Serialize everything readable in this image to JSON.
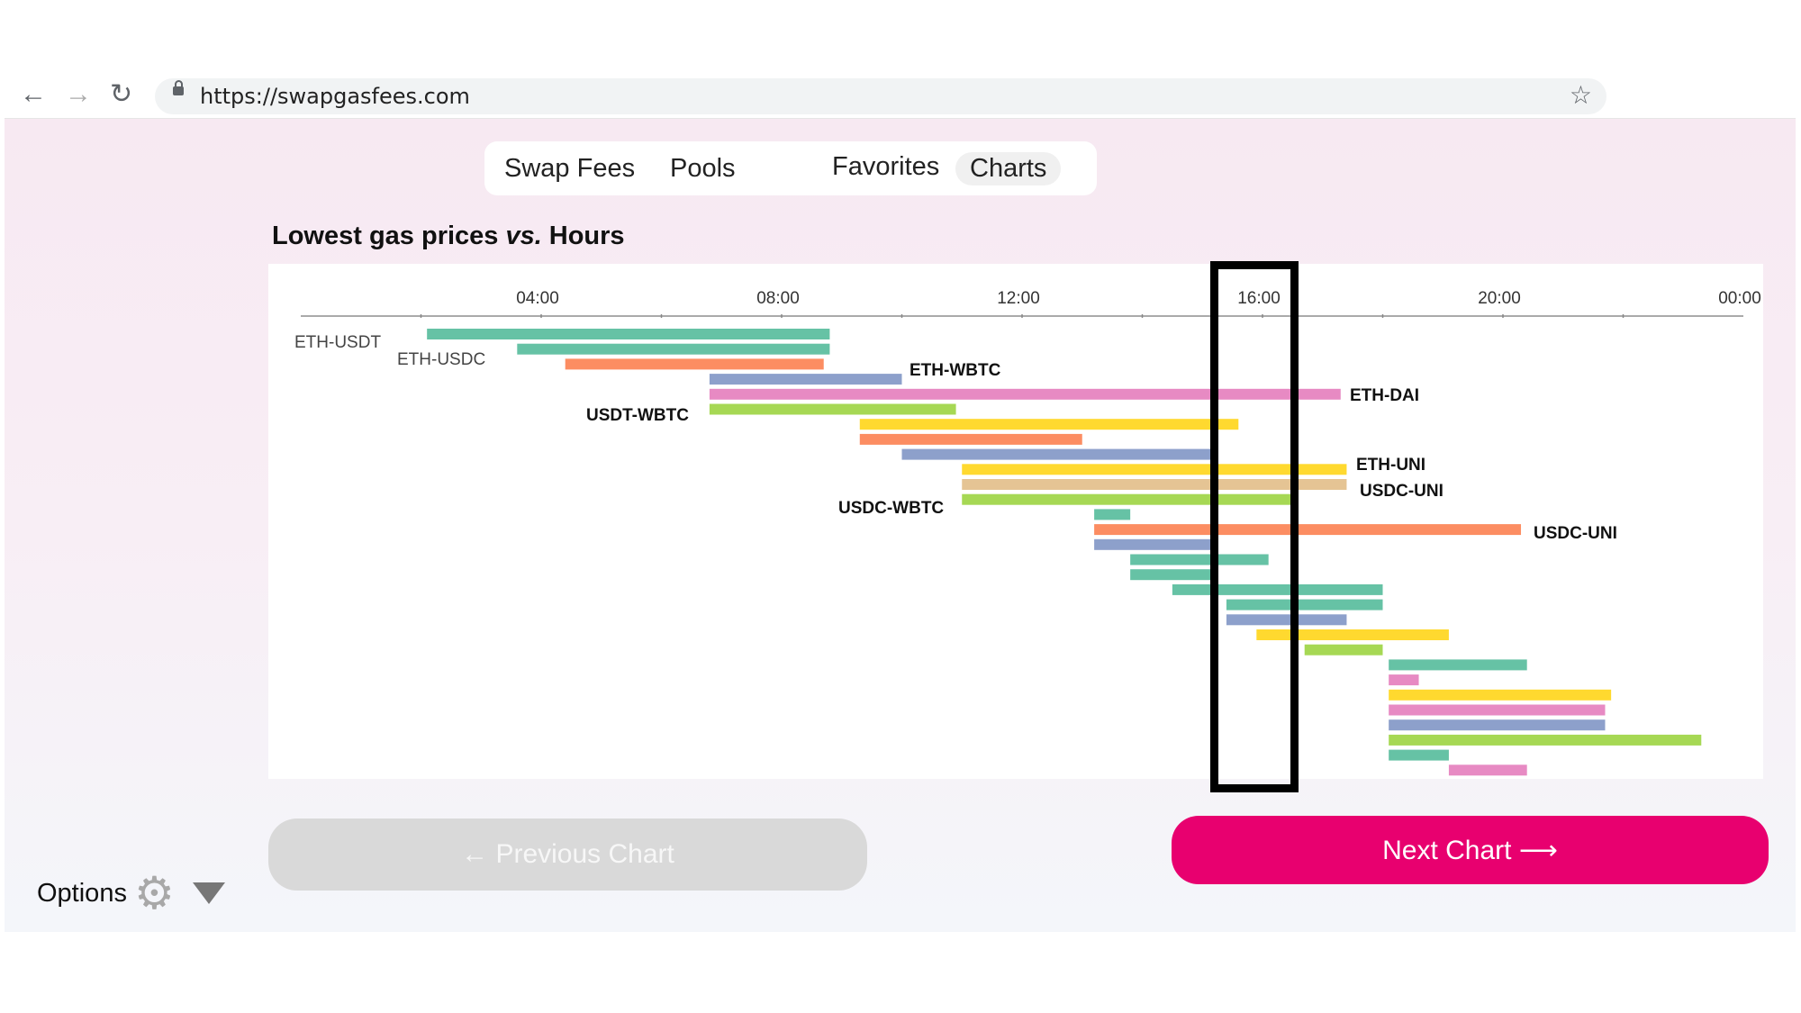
{
  "browser": {
    "url": "https://swapgasfees.com",
    "back_icon": "←",
    "forward_icon": "→",
    "reload_icon": "↻",
    "star_icon": "☆"
  },
  "nav": {
    "tabs": [
      {
        "label": "Swap Fees",
        "active": false
      },
      {
        "label": "Pools",
        "active": false
      },
      {
        "label": "Favorites",
        "active": false
      },
      {
        "label": "Charts",
        "active": true
      }
    ]
  },
  "title": {
    "part1": "Lowest gas prices",
    "part2": "vs.",
    "part3": "Hours"
  },
  "chart_data": {
    "type": "bar",
    "orientation": "horizontal-range",
    "x_ticks": [
      "04:00",
      "08:00",
      "12:00",
      "16:00",
      "20:00",
      "00:00"
    ],
    "x_tick_hours": [
      4,
      8,
      12,
      16,
      20,
      24
    ],
    "xlim_hours": [
      0,
      24
    ],
    "highlight_range_hours": [
      15.3,
      17.0
    ],
    "colors": {
      "teal": "#66c2a5",
      "orange": "#fc8d62",
      "blue": "#8da0cb",
      "pink": "#e78ac3",
      "green": "#a6d854",
      "yellow": "#ffd92f",
      "tan": "#e5c494",
      "highlight": "#000000"
    },
    "bars": [
      {
        "start": 2.1,
        "end": 8.8,
        "color": "#66c2a5",
        "label": "ETH-USDT"
      },
      {
        "start": 3.6,
        "end": 8.8,
        "color": "#66c2a5",
        "label": "ETH-USDC"
      },
      {
        "start": 4.4,
        "end": 8.7,
        "color": "#fc8d62"
      },
      {
        "start": 6.8,
        "end": 10.0,
        "color": "#8da0cb",
        "label": "ETH-WBTC"
      },
      {
        "start": 6.8,
        "end": 17.3,
        "color": "#e78ac3",
        "label": "ETH-DAI"
      },
      {
        "start": 6.8,
        "end": 10.9,
        "color": "#a6d854",
        "label": "USDT-WBTC"
      },
      {
        "start": 9.3,
        "end": 15.6,
        "color": "#ffd92f"
      },
      {
        "start": 9.3,
        "end": 13.0,
        "color": "#fc8d62"
      },
      {
        "start": 10.0,
        "end": 15.2,
        "color": "#8da0cb"
      },
      {
        "start": 11.0,
        "end": 17.4,
        "color": "#ffd92f",
        "label": "ETH-UNI"
      },
      {
        "start": 11.0,
        "end": 17.4,
        "color": "#e5c494",
        "label": "USDC-UNI"
      },
      {
        "start": 11.0,
        "end": 16.5,
        "color": "#a6d854",
        "label": "USDC-WBTC"
      },
      {
        "start": 13.2,
        "end": 13.8,
        "color": "#66c2a5"
      },
      {
        "start": 13.2,
        "end": 20.3,
        "color": "#fc8d62",
        "label": "USDC-UNI"
      },
      {
        "start": 13.2,
        "end": 15.2,
        "color": "#8da0cb"
      },
      {
        "start": 13.8,
        "end": 16.1,
        "color": "#66c2a5"
      },
      {
        "start": 13.8,
        "end": 15.2,
        "color": "#66c2a5"
      },
      {
        "start": 14.5,
        "end": 18.0,
        "color": "#66c2a5"
      },
      {
        "start": 15.4,
        "end": 18.0,
        "color": "#66c2a5"
      },
      {
        "start": 15.4,
        "end": 17.4,
        "color": "#8da0cb"
      },
      {
        "start": 15.9,
        "end": 19.1,
        "color": "#ffd92f"
      },
      {
        "start": 16.7,
        "end": 18.0,
        "color": "#a6d854"
      },
      {
        "start": 18.1,
        "end": 20.4,
        "color": "#66c2a5"
      },
      {
        "start": 18.1,
        "end": 18.6,
        "color": "#e78ac3"
      },
      {
        "start": 18.1,
        "end": 21.8,
        "color": "#ffd92f"
      },
      {
        "start": 18.1,
        "end": 21.7,
        "color": "#e78ac3"
      },
      {
        "start": 18.1,
        "end": 21.7,
        "color": "#8da0cb"
      },
      {
        "start": 18.1,
        "end": 23.3,
        "color": "#a6d854"
      },
      {
        "start": 18.1,
        "end": 19.1,
        "color": "#66c2a5"
      },
      {
        "start": 19.1,
        "end": 20.4,
        "color": "#e78ac3"
      }
    ]
  },
  "buttons": {
    "prev_label": "← Previous Chart",
    "next_label": "Next Chart ⟶"
  },
  "options": {
    "label": "Options",
    "gear_icon": "⚙"
  }
}
